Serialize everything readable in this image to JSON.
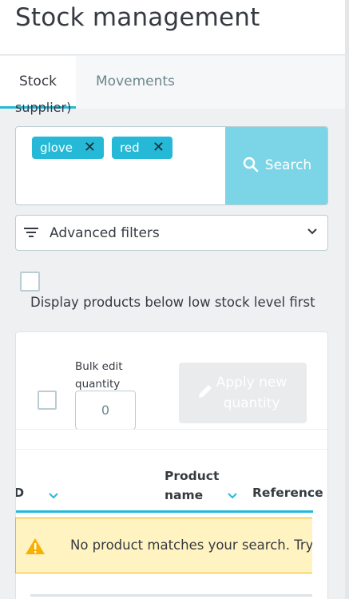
{
  "header": {
    "title": "Stock management"
  },
  "tabs": [
    {
      "label": "Stock",
      "active": true
    },
    {
      "label": "Movements",
      "active": false
    }
  ],
  "search": {
    "clipped_label": "supplier)",
    "tags": [
      "glove",
      "red"
    ],
    "button_label": "Search",
    "icon": "search-icon"
  },
  "filters": {
    "label": "Advanced filters",
    "icon": "filter-icon"
  },
  "low_stock": {
    "label": "Display products below low stock level first",
    "checked": false
  },
  "bulk": {
    "label": "Bulk edit quantity",
    "quantity_value": "0",
    "apply_label": "Apply new quantity",
    "apply_icon": "pencil-icon"
  },
  "table": {
    "columns": [
      {
        "label": "ID",
        "sortable": true
      },
      {
        "label": "Product name",
        "sortable": true
      },
      {
        "label": "Reference",
        "sortable": true
      }
    ],
    "empty_message": "No product matches your search. Try changing search terms."
  },
  "colors": {
    "accent": "#25b9d7",
    "search_button": "#7cd5e7",
    "warning_bg": "#fff3c2",
    "warning_border": "#fab000"
  }
}
